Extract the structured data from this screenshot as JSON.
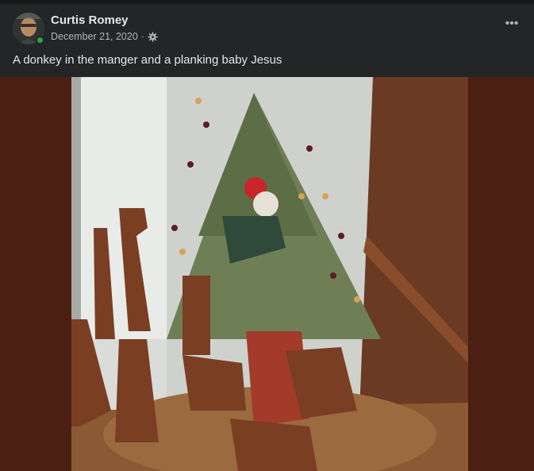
{
  "post": {
    "author": "Curtis Romey",
    "date": "December 21, 2020",
    "separator": "·",
    "privacy_icon": "gear-icon",
    "more_label": "•••",
    "caption": "A donkey in the manger and a planking baby Jesus"
  },
  "colors": {
    "background": "#242526",
    "text_primary": "#e4e6eb",
    "text_secondary": "#b0b3b8",
    "online": "#31a24c",
    "photo_letterbox": "#4b1f12"
  }
}
